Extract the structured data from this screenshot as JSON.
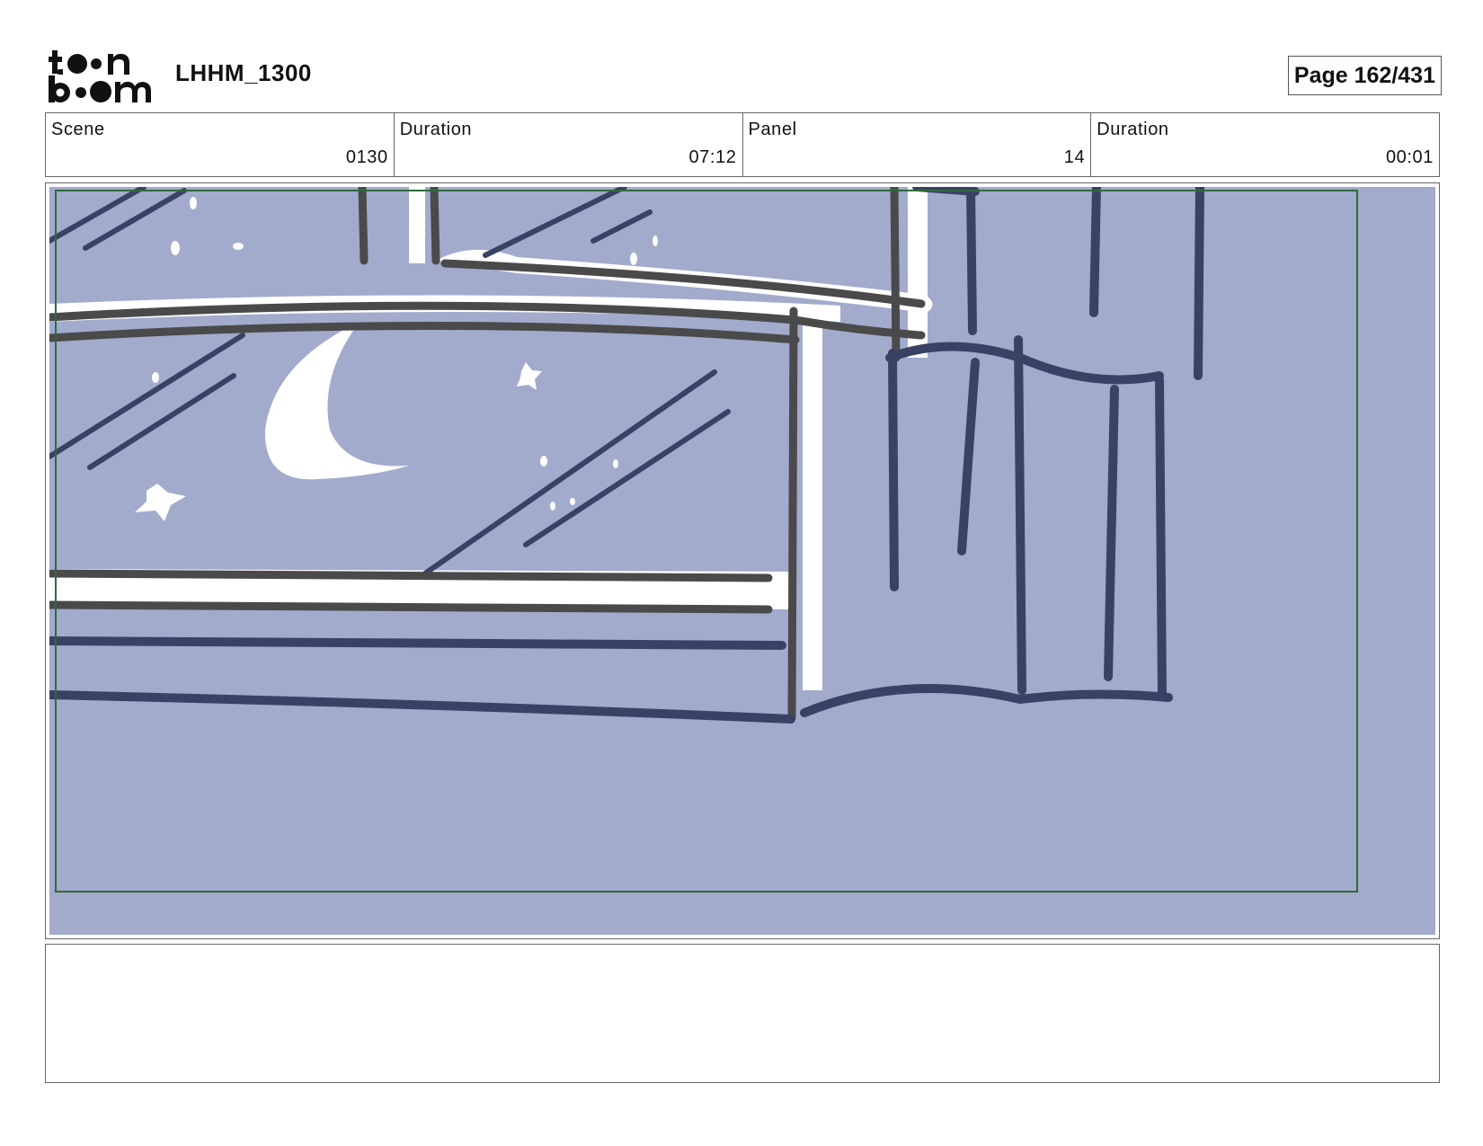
{
  "header": {
    "logo_text": "toonboom",
    "project_name": "LHHM_1300",
    "page_label": "Page 162/431"
  },
  "info": {
    "scene_label": "Scene",
    "scene_value": "0130",
    "scene_duration_label": "Duration",
    "scene_duration_value": "07:12",
    "panel_label": "Panel",
    "panel_value": "14",
    "panel_duration_label": "Duration",
    "panel_duration_value": "00:01"
  },
  "panel": {
    "background_color": "#a2abcc",
    "line_color": "#394264",
    "frame_line_color": "#4a4a4a",
    "safe_frame_color": "#2f6b3a"
  },
  "notes": {
    "text": ""
  }
}
